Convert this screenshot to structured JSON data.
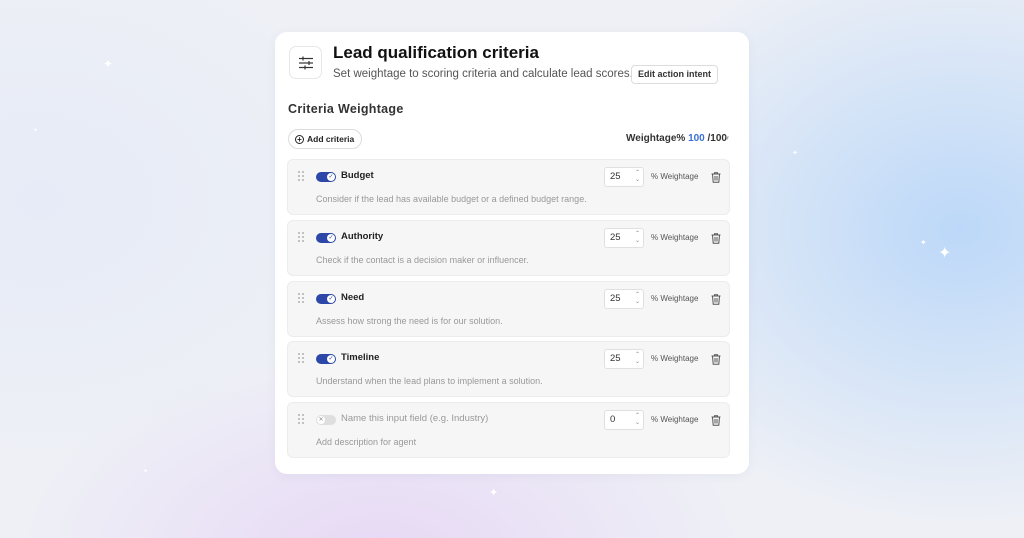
{
  "header": {
    "icon": "sliders-icon",
    "title": "Lead qualification criteria",
    "subtitle": "Set weightage to scoring criteria and calculate lead scores.",
    "edit_intent_label": "Edit action intent"
  },
  "section": {
    "title": "Criteria Weightage",
    "add_criteria_label": "Add criteria",
    "weightage_label": "Weightage%",
    "weightage_value": "100",
    "weightage_max": "/100"
  },
  "criteria": [
    {
      "enabled": true,
      "name": "Budget",
      "description": "Consider if the lead has available budget or a defined budget range.",
      "weight": "25",
      "weight_label": "% Weightage"
    },
    {
      "enabled": true,
      "name": "Authority",
      "description": "Check if the contact is a decision maker or influencer.",
      "weight": "25",
      "weight_label": "% Weightage"
    },
    {
      "enabled": true,
      "name": "Need",
      "description": "Assess how strong the need is for our solution.",
      "weight": "25",
      "weight_label": "% Weightage"
    },
    {
      "enabled": true,
      "name": "Timeline",
      "description": "Understand when the lead plans to implement a solution.",
      "weight": "25",
      "weight_label": "% Weightage"
    },
    {
      "enabled": false,
      "name": "Name this input field (e.g. Industry)",
      "description": "Add description for agent",
      "weight": "0",
      "weight_label": "% Weightage"
    }
  ],
  "colors": {
    "accent": "#2c47a8",
    "link_blue": "#3b6fd4"
  }
}
